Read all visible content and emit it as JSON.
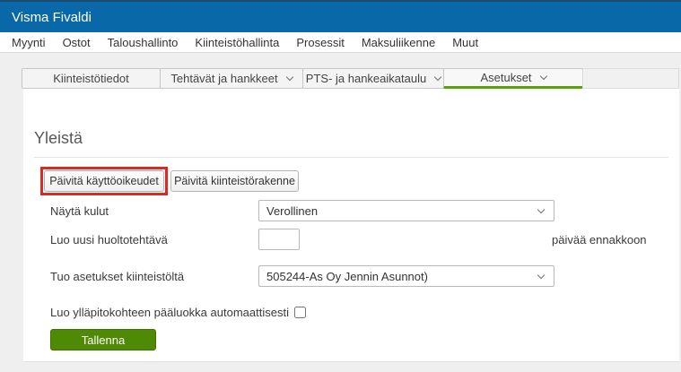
{
  "app": {
    "title": "Visma Fivaldi"
  },
  "menu": {
    "items": [
      {
        "label": "Myynti"
      },
      {
        "label": "Ostot"
      },
      {
        "label": "Taloushallinto"
      },
      {
        "label": "Kiinteistöhallinta"
      },
      {
        "label": "Prosessit"
      },
      {
        "label": "Maksuliikenne"
      },
      {
        "label": "Muut"
      }
    ]
  },
  "tabs": {
    "items": [
      {
        "label": "Kiinteistötiedot",
        "has_dropdown": false,
        "active": false
      },
      {
        "label": "Tehtävät ja hankkeet",
        "has_dropdown": true,
        "active": false
      },
      {
        "label": "PTS- ja hankeaikataulu",
        "has_dropdown": true,
        "active": false
      },
      {
        "label": "Asetukset",
        "has_dropdown": true,
        "active": true
      }
    ]
  },
  "content": {
    "section_title": "Yleistä",
    "buttons": {
      "update_permissions": "Päivitä käyttöoikeudet",
      "update_structure": "Päivitä kiinteistörakenne",
      "save": "Tallenna"
    },
    "form": {
      "rows": [
        {
          "label": "Näytä kulut",
          "type": "select",
          "value": "Verollinen"
        },
        {
          "label": "Luo uusi huoltotehtävä",
          "type": "text",
          "value": "",
          "suffix": "päivää ennakkoon"
        },
        {
          "label": "Tuo asetukset kiinteistöltä",
          "type": "select",
          "value": "505244-As Oy Jennin Asunnot)"
        },
        {
          "label": "Luo ylläpitokohteen pääluokka automaattisesti",
          "type": "checkbox",
          "checked": false
        }
      ]
    }
  },
  "colors": {
    "header_blue": "#0868a8",
    "active_tab_green": "#58a30c",
    "save_green": "#4f8a05",
    "highlight_red": "#d92b21"
  }
}
